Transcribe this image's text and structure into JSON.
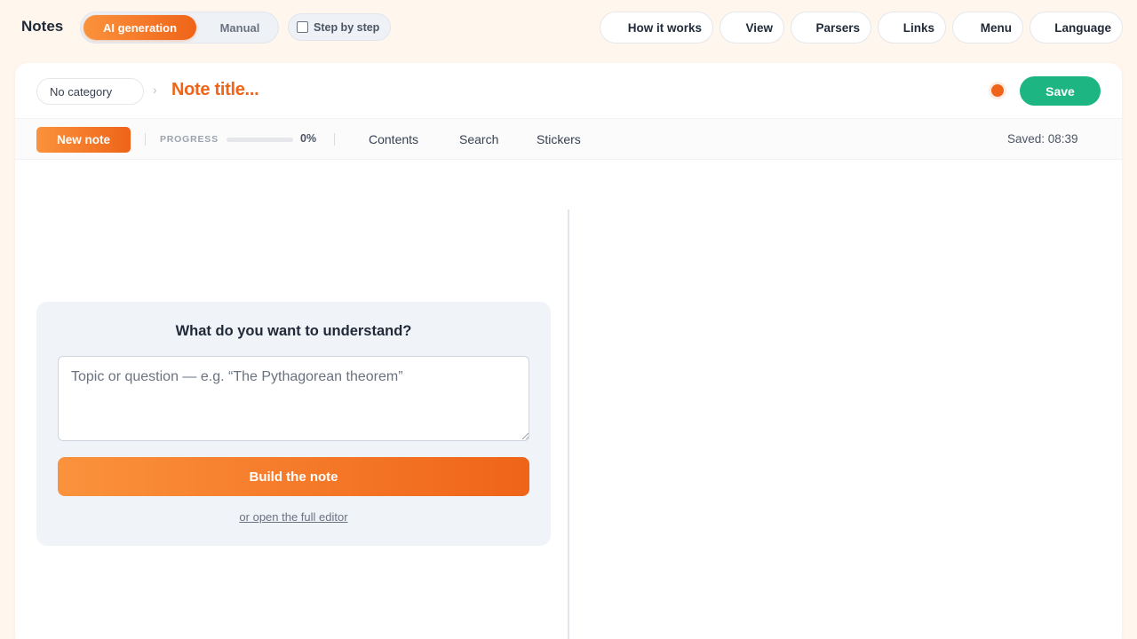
{
  "app": {
    "title": "Notes"
  },
  "modes": {
    "ai": "AI generation",
    "manual": "Manual"
  },
  "step_toggle": {
    "label": "Step by step",
    "checked": false
  },
  "nav": [
    {
      "label": "How it works"
    },
    {
      "label": "View"
    },
    {
      "label": "Parsers"
    },
    {
      "label": "Links"
    },
    {
      "label": "Menu"
    },
    {
      "label": "Language"
    }
  ],
  "header": {
    "category": "No category",
    "title": "Note title...",
    "save_label": "Save"
  },
  "toolbar": {
    "new_note_label": "New note",
    "progress_label": "PROGRESS",
    "progress_value": 0,
    "progress_text": "0%",
    "links": [
      "Contents",
      "Search",
      "Stickers"
    ],
    "saved_text": "Saved: 08:39"
  },
  "prompt": {
    "heading": "What do you want to understand?",
    "placeholder": "Topic or question — e.g. “The Pythagorean theorem”",
    "value": "",
    "build_label": "Build the note",
    "editor_link": "or open the full editor"
  },
  "colors": {
    "accent": "#ef6418",
    "accent_light": "#fb923c",
    "save_green": "#1db582",
    "background": "#fff6ee"
  }
}
